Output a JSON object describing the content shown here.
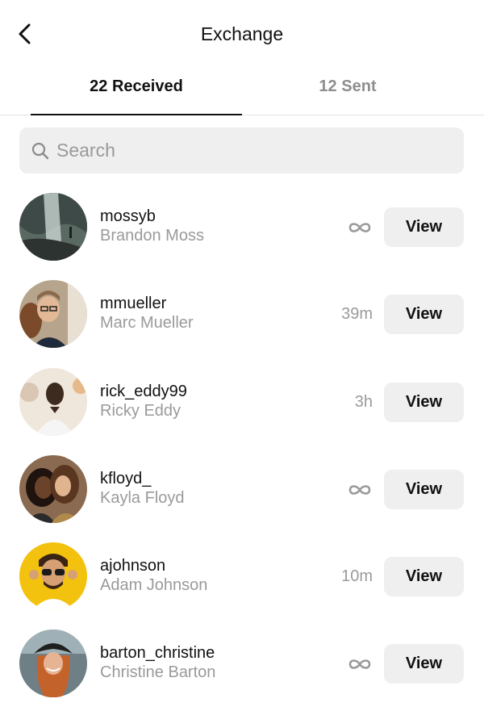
{
  "header": {
    "title": "Exchange",
    "back_icon": "chevron-left-icon"
  },
  "tabs": [
    {
      "label": "22 Received",
      "active": true
    },
    {
      "label": "12 Sent",
      "active": false
    }
  ],
  "search": {
    "placeholder": "Search",
    "value": "",
    "icon": "search-icon"
  },
  "list": {
    "items": [
      {
        "username": "mossyb",
        "name": "Brandon Moss",
        "time": "",
        "time_icon": "infinity-icon",
        "action": "View"
      },
      {
        "username": "mmueller",
        "name": "Marc Mueller",
        "time": "39m",
        "time_icon": "",
        "action": "View"
      },
      {
        "username": "rick_eddy99",
        "name": "Ricky Eddy",
        "time": "3h",
        "time_icon": "",
        "action": "View"
      },
      {
        "username": "kfloyd_",
        "name": "Kayla Floyd",
        "time": "",
        "time_icon": "infinity-icon",
        "action": "View"
      },
      {
        "username": "ajohnson",
        "name": "Adam Johnson",
        "time": "10m",
        "time_icon": "",
        "action": "View"
      },
      {
        "username": "barton_christine",
        "name": "Christine Barton",
        "time": "",
        "time_icon": "infinity-icon",
        "action": "View"
      }
    ]
  },
  "colors": {
    "text_primary": "#111111",
    "text_secondary": "#9a9a9a",
    "button_bg": "#efefef",
    "accent_yellow": "#f2c20f"
  }
}
